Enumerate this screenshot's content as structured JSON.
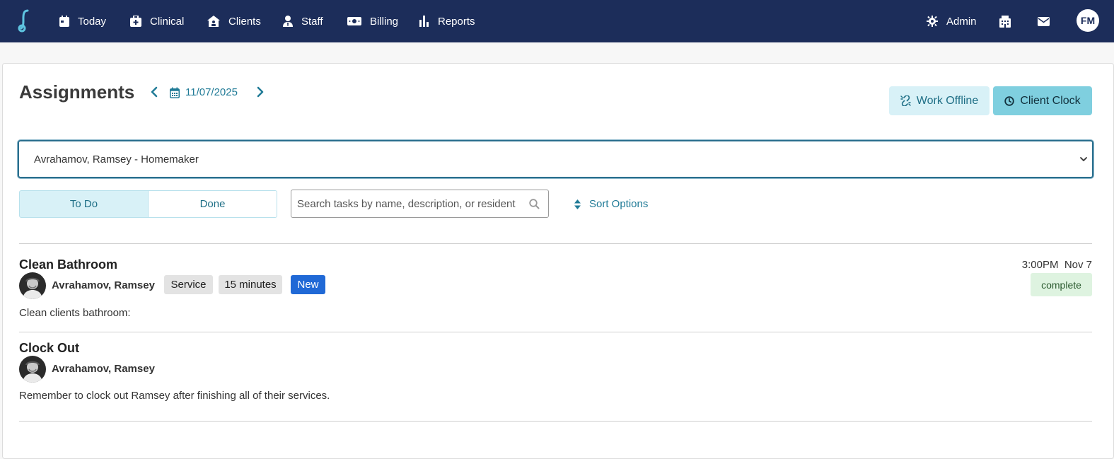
{
  "nav": {
    "items": [
      {
        "label": "Today",
        "icon": "calendar-icon"
      },
      {
        "label": "Clinical",
        "icon": "medical-kit-icon"
      },
      {
        "label": "Clients",
        "icon": "house-user-icon"
      },
      {
        "label": "Staff",
        "icon": "user-tie-icon"
      },
      {
        "label": "Billing",
        "icon": "money-bill-icon"
      },
      {
        "label": "Reports",
        "icon": "bar-chart-icon"
      }
    ],
    "admin_label": "Admin",
    "user_initials": "FM",
    "colors": {
      "bar": "#1c2d5a",
      "logo": "#5ec3e0"
    }
  },
  "page": {
    "title": "Assignments",
    "date": "11/07/2025",
    "work_offline_label": "Work Offline",
    "client_clock_label": "Client Clock",
    "selected_assignment": "Avrahamov, Ramsey - Homemaker",
    "tabs": {
      "todo": "To Do",
      "done": "Done",
      "active": "todo"
    },
    "search_placeholder": "Search tasks by name, description, or resident",
    "sort_label": "Sort Options"
  },
  "tasks": [
    {
      "title": "Clean Bathroom",
      "client": "Avrahamov, Ramsey",
      "tags": [
        "Service",
        "15 minutes"
      ],
      "badge": "New",
      "description": "Clean clients bathroom:",
      "time": "3:00PM",
      "date": "Nov 7",
      "status": "complete"
    },
    {
      "title": "Clock Out",
      "client": "Avrahamov, Ramsey",
      "description": "Remember to clock out Ramsey after finishing all of their services."
    }
  ]
}
